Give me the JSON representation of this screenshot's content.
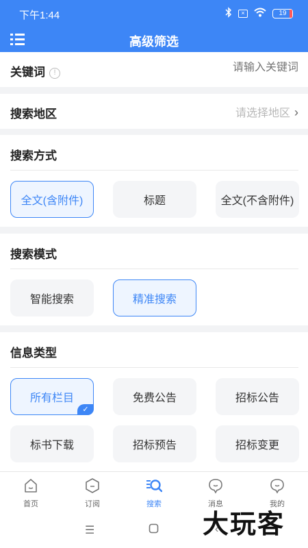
{
  "status": {
    "time": "下午1:44",
    "battery": "19"
  },
  "header": {
    "title": "高级筛选"
  },
  "keyword": {
    "label": "关键词",
    "placeholder": "请输入关键词"
  },
  "region": {
    "label": "搜索地区",
    "placeholder": "请选择地区"
  },
  "search_method": {
    "title": "搜索方式",
    "options": [
      "全文(含附件)",
      "标题",
      "全文(不含附件)"
    ],
    "selected": "全文(含附件)"
  },
  "search_mode": {
    "title": "搜索模式",
    "options": [
      "智能搜索",
      "精准搜索"
    ],
    "selected": "精准搜索"
  },
  "info_type": {
    "title": "信息类型",
    "options": [
      "所有栏目",
      "免费公告",
      "招标公告",
      "标书下载",
      "招标预告",
      "招标变更"
    ],
    "selected": "所有栏目"
  },
  "tabs": [
    {
      "label": "首页"
    },
    {
      "label": "订阅"
    },
    {
      "label": "搜索"
    },
    {
      "label": "消息"
    },
    {
      "label": "我的"
    }
  ],
  "active_tab": "搜索",
  "watermark": "大玩客",
  "colors": {
    "accent": "#3d86f6",
    "background": "#f2f3f5"
  }
}
